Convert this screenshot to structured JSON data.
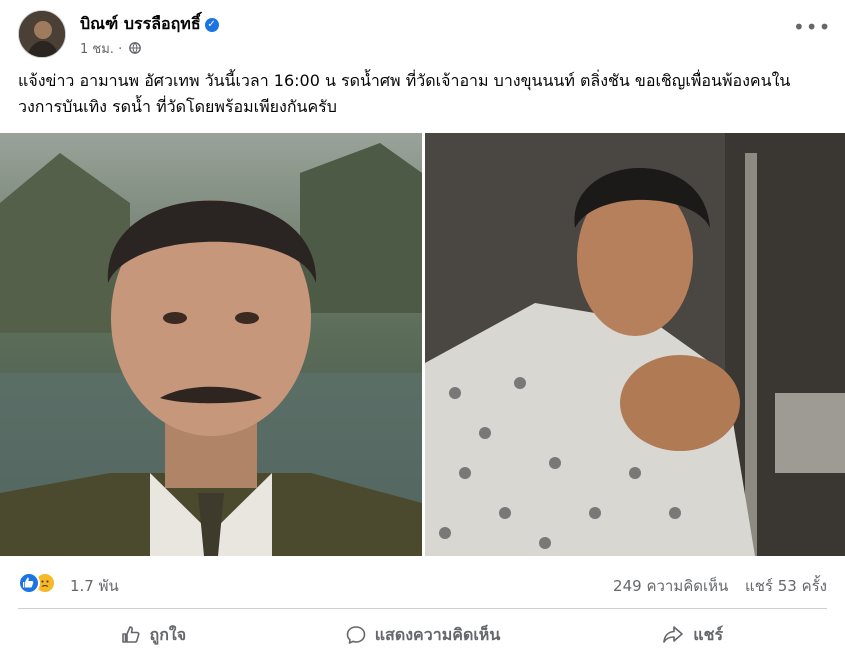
{
  "post": {
    "author": "บิณฑ์ บรรลือฤทธิ์",
    "time": "1 ชม.",
    "separator": "·",
    "text": "แจ้งข่าว อามานพ อัศวเทพ วันนี้เวลา 16:00 น รดน้ำศพ ที่วัดเจ้าอาม บางขุนนนท์ ตลิ่งชัน ขอเชิญเพื่อนพ้องคนในวงการบันเทิง รดน้ำ ที่วัดโดยพร้อมเพียงกันครับ"
  },
  "engagement": {
    "reactions_count": "1.7 พัน",
    "comments": "249 ความคิดเห็น",
    "shares": "แชร์ 53 ครั้ง"
  },
  "actions": {
    "like": "ถูกใจ",
    "comment": "แสดงความคิดเห็น",
    "share": "แชร์"
  },
  "colors": {
    "like_blue": "#1b74e4",
    "care_yellow": "#f7b928",
    "muted_text": "#65676b"
  }
}
